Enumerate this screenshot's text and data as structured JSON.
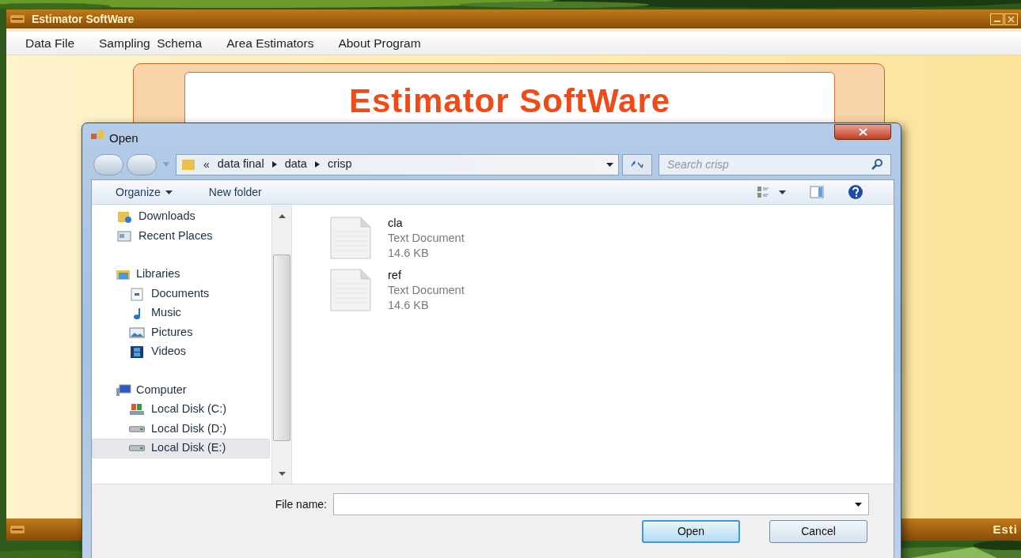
{
  "app": {
    "title": "Estimator SoftWare",
    "menu": [
      "Data File",
      "Sampling  Schema",
      "Area Estimators",
      "About Program"
    ],
    "banner_title": "Estimator SoftWare",
    "status_text": "Esti"
  },
  "dialog": {
    "title": "Open",
    "address": {
      "overflow": "«",
      "parts": [
        "data final",
        "data",
        "crisp"
      ]
    },
    "search": {
      "placeholder": "Search crisp"
    },
    "toolbar": [
      {
        "label": "Organize",
        "dropdown": true
      },
      {
        "label": "New folder",
        "dropdown": false
      }
    ],
    "nav_sections": [
      {
        "children": [
          {
            "label": "Downloads",
            "kind": "downloads",
            "selected": false
          },
          {
            "label": "Recent Places",
            "kind": "recent",
            "selected": false
          }
        ]
      },
      {
        "label": "Libraries",
        "kind": "libraries",
        "children": [
          {
            "label": "Documents",
            "kind": "documents",
            "selected": false
          },
          {
            "label": "Music",
            "kind": "music",
            "selected": false
          },
          {
            "label": "Pictures",
            "kind": "pictures",
            "selected": false
          },
          {
            "label": "Videos",
            "kind": "videos",
            "selected": false
          }
        ]
      },
      {
        "label": "Computer",
        "kind": "computer",
        "children": [
          {
            "label": "Local Disk (C:)",
            "kind": "system-disk",
            "selected": false
          },
          {
            "label": "Local Disk (D:)",
            "kind": "disk",
            "selected": false
          },
          {
            "label": "Local Disk (E:)",
            "kind": "disk",
            "selected": true
          }
        ]
      }
    ],
    "files": [
      {
        "name": "cla",
        "type": "Text Document",
        "size": "14.6 KB"
      },
      {
        "name": "ref",
        "type": "Text Document",
        "size": "14.6 KB"
      }
    ],
    "file_name": {
      "label": "File name:"
    },
    "buttons": [
      {
        "label": "Open",
        "default": true
      },
      {
        "label": "Cancel",
        "default": false
      }
    ]
  }
}
